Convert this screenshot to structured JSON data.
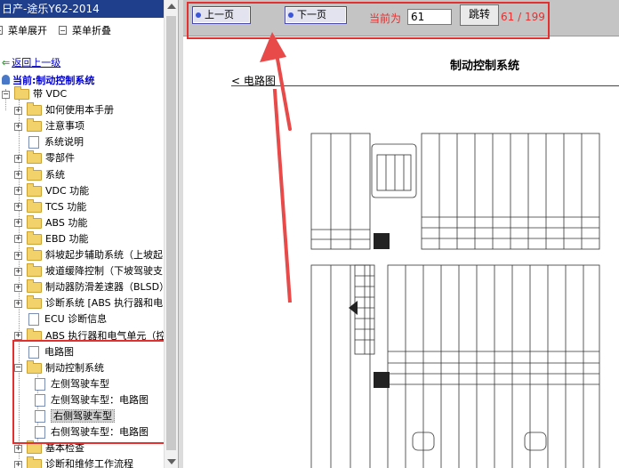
{
  "window": {
    "title": "日产-途乐Y62-2014"
  },
  "toolbar": {
    "expand_label": "菜单展开",
    "collapse_label": "菜单折叠"
  },
  "nav": {
    "back_label": "返回上一级",
    "current_label": "当前:制动控制系统"
  },
  "tree": [
    {
      "label": "带 VDC",
      "indent": 0,
      "icon": "folder",
      "expander": "minus"
    },
    {
      "label": "如何使用本手册",
      "indent": 1,
      "icon": "folder",
      "expander": "plus"
    },
    {
      "label": "注意事项",
      "indent": 1,
      "icon": "folder",
      "expander": "plus"
    },
    {
      "label": "系统说明",
      "indent": 1,
      "icon": "doc",
      "expander": ""
    },
    {
      "label": "零部件",
      "indent": 1,
      "icon": "folder",
      "expander": "plus"
    },
    {
      "label": "系统",
      "indent": 1,
      "icon": "folder",
      "expander": "plus"
    },
    {
      "label": "VDC 功能",
      "indent": 1,
      "icon": "folder",
      "expander": "plus"
    },
    {
      "label": "TCS 功能",
      "indent": 1,
      "icon": "folder",
      "expander": "plus"
    },
    {
      "label": "ABS 功能",
      "indent": 1,
      "icon": "folder",
      "expander": "plus"
    },
    {
      "label": "EBD 功能",
      "indent": 1,
      "icon": "folder",
      "expander": "plus"
    },
    {
      "label": "斜坡起步辅助系统（上坡起",
      "indent": 1,
      "icon": "folder",
      "expander": "plus"
    },
    {
      "label": "坡道缓降控制（下坡驾驶支",
      "indent": 1,
      "icon": "folder",
      "expander": "plus"
    },
    {
      "label": "制动器防滑差速器（BLSD）",
      "indent": 1,
      "icon": "folder",
      "expander": "plus"
    },
    {
      "label": "诊断系统 [ABS 执行器和电",
      "indent": 1,
      "icon": "folder",
      "expander": "plus"
    },
    {
      "label": "ECU 诊断信息",
      "indent": 1,
      "icon": "doc",
      "expander": ""
    },
    {
      "label": "ABS 执行器和电气单元（控",
      "indent": 1,
      "icon": "folder",
      "expander": "plus"
    },
    {
      "label": "电路图",
      "indent": 1,
      "icon": "doc",
      "expander": ""
    },
    {
      "label": "制动控制系统",
      "indent": 1,
      "icon": "folder",
      "expander": "minus"
    },
    {
      "label": "左侧驾驶车型",
      "indent": 2,
      "icon": "doc",
      "expander": ""
    },
    {
      "label": "左侧驾驶车型：电路图",
      "indent": 2,
      "icon": "doc",
      "expander": ""
    },
    {
      "label": "右侧驾驶车型",
      "indent": 2,
      "icon": "doc",
      "expander": "",
      "selected": true
    },
    {
      "label": "右侧驾驶车型：电路图",
      "indent": 2,
      "icon": "doc",
      "expander": ""
    },
    {
      "label": "基本检查",
      "indent": 1,
      "icon": "folder",
      "expander": "plus"
    },
    {
      "label": "诊断和维修工作流程",
      "indent": 1,
      "icon": "folder",
      "expander": "plus"
    }
  ],
  "pager": {
    "prev_label": "上一页",
    "next_label": "下一页",
    "current_label": "当前为",
    "current_value": "61",
    "jump_label": "跳转",
    "total_text": "61 / 199"
  },
  "document": {
    "title": "制动控制系统",
    "breadcrumb": "< 电路图"
  },
  "colors": {
    "highlight": "#e53030",
    "titlebar": "#1f3f8c",
    "link": "#0000cc"
  }
}
